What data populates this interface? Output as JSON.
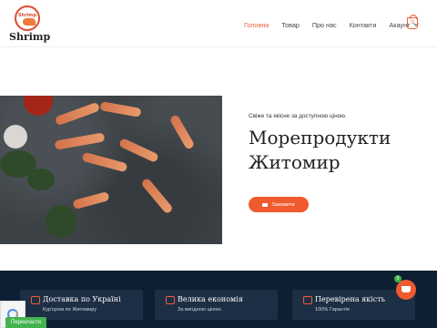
{
  "brand": {
    "logo_text": "Shrimp",
    "badge_text": "Shrimp"
  },
  "nav": {
    "items": [
      {
        "label": "Головна",
        "active": true
      },
      {
        "label": "Товар"
      },
      {
        "label": "Про нас"
      },
      {
        "label": "Контакти"
      },
      {
        "label": "Акаунт"
      }
    ],
    "cart_count": "0"
  },
  "hero": {
    "tagline": "Свіже та якісне за доступною ціною.",
    "title": "Морепродукти Житомир",
    "button_label": "Замовити"
  },
  "features": [
    {
      "title": "Доставка по Україні",
      "subtitle": "Кур'єром по Житомиру",
      "icon": "truck-icon"
    },
    {
      "title": "Велика економія",
      "subtitle": "За вигідною ціною.",
      "icon": "money-icon"
    },
    {
      "title": "Перевірена якість",
      "subtitle": "100% Гарантія",
      "icon": "heart-icon"
    }
  ],
  "floating_cart": {
    "count": "0"
  },
  "translate_label": "Перекласти",
  "colors": {
    "accent": "#ef5a2f",
    "footer_bg": "#0f1f33"
  }
}
